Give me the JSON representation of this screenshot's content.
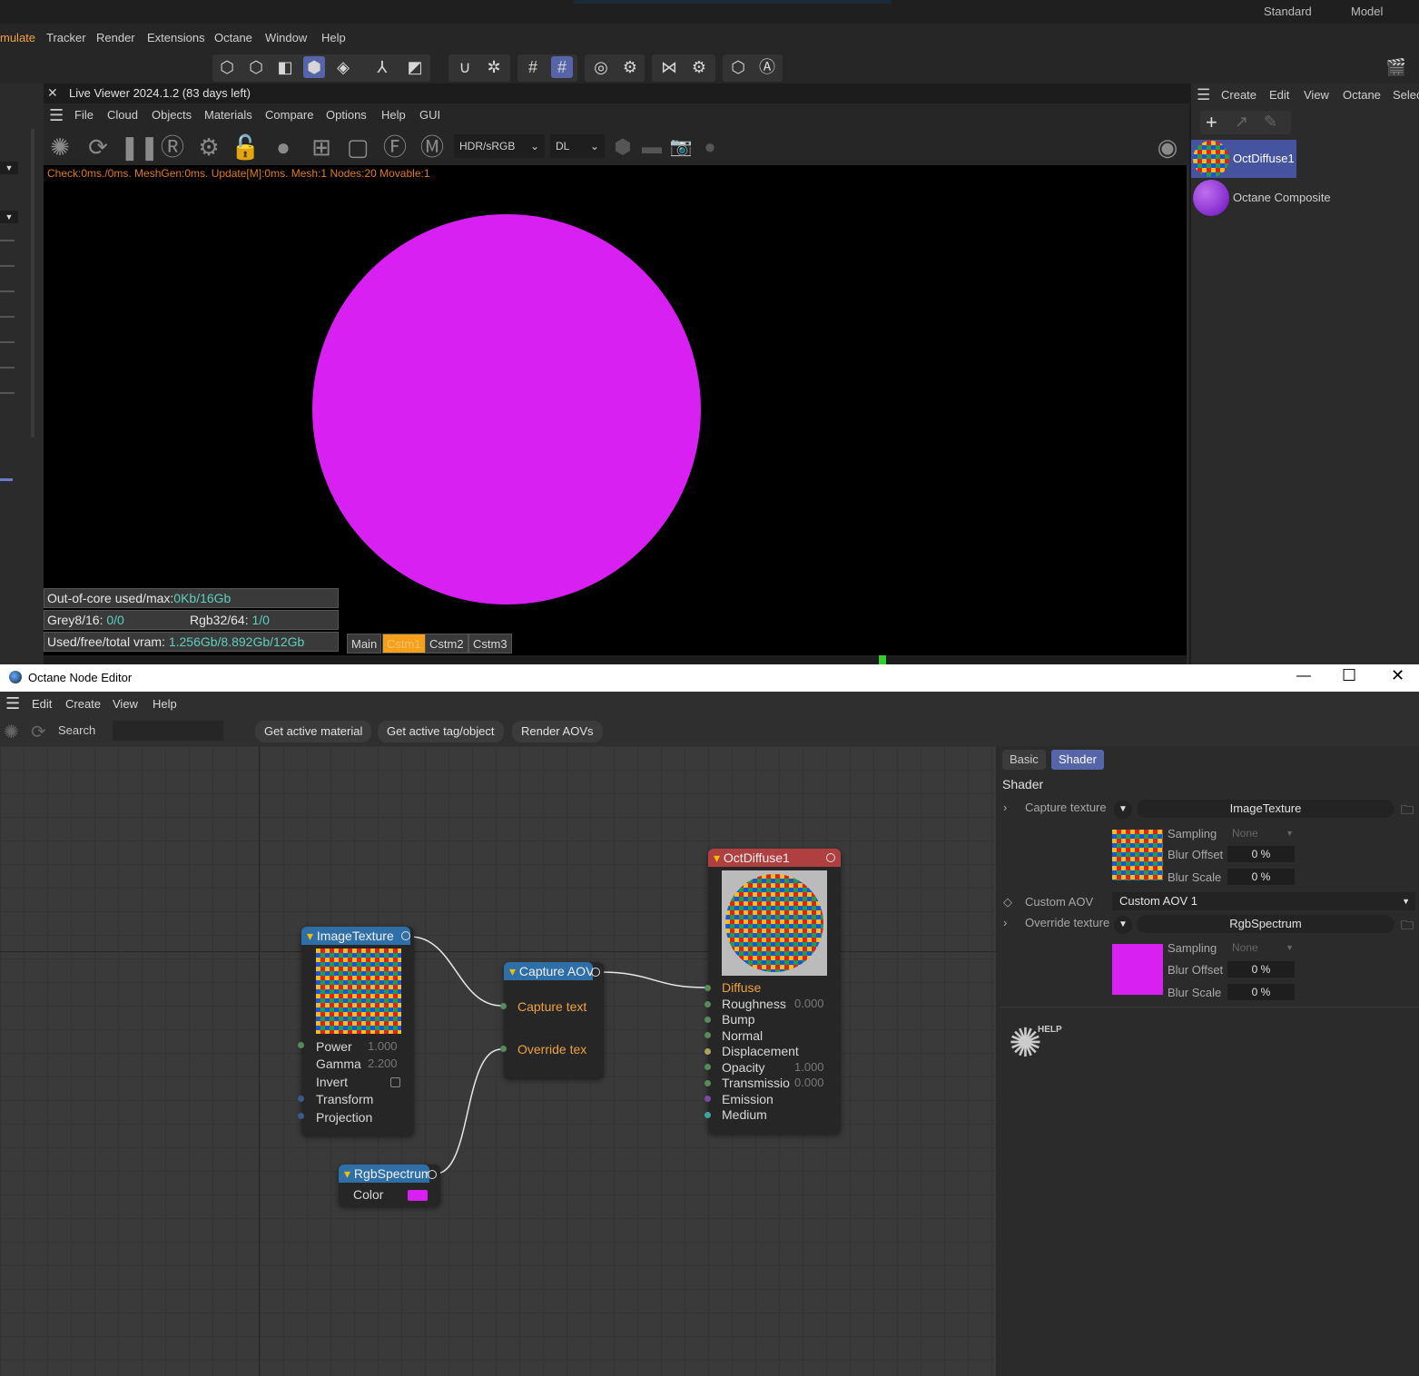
{
  "topbar": {
    "layout_1": "Standard",
    "layout_2": "Model"
  },
  "app_menu": [
    "mulate",
    "Tracker",
    "Render",
    "Extensions",
    "Octane",
    "Window",
    "Help"
  ],
  "live_viewer": {
    "title": "Live Viewer 2024.1.2 (83 days left)",
    "menu": [
      "File",
      "Cloud",
      "Objects",
      "Materials",
      "Compare",
      "Options",
      "Help",
      "GUI"
    ],
    "dropdown_1": "HDR/sRGB",
    "dropdown_2": "DL",
    "stats": "Check:0ms./0ms. MeshGen:0ms. Update[M]:0ms. Mesh:1 Nodes:20 Movable:1",
    "ooc_label": "Out-of-core used/max:",
    "ooc_value": "0Kb/16Gb",
    "grey_label": "Grey8/16: ",
    "grey_value": "0/0",
    "rgb_label": "Rgb32/64: ",
    "rgb_value": "1/0",
    "vram_label": "Used/free/total vram: ",
    "vram_value": "1.256Gb/8.892Gb/12Gb",
    "tabs": [
      "Main",
      "Cstm1",
      "Cstm2",
      "Cstm3"
    ],
    "sphere_color": "#d820f3"
  },
  "material_panel": {
    "menu": [
      "Create",
      "Edit",
      "View",
      "Octane",
      "Selec"
    ],
    "materials": [
      {
        "name": "OctDiffuse1"
      },
      {
        "name": "Octane Composite"
      }
    ]
  },
  "node_editor": {
    "title": "Octane Node Editor",
    "menu": [
      "Edit",
      "Create",
      "View",
      "Help"
    ],
    "search_label": "Search",
    "buttons": [
      "Get active material",
      "Get active tag/object",
      "Render AOVs"
    ],
    "nodes": {
      "image_texture": {
        "title": "ImageTexture",
        "pins": [
          {
            "label": "Power",
            "value": "1.000"
          },
          {
            "label": "Gamma",
            "value": "2.200"
          },
          {
            "label": "Invert",
            "value": ""
          },
          {
            "label": "Transform",
            "value": ""
          },
          {
            "label": "Projection",
            "value": ""
          }
        ]
      },
      "rgb_spectrum": {
        "title": "RgbSpectrum",
        "pin": "Color",
        "color": "#d820f3"
      },
      "capture_aov": {
        "title": "Capture AOV",
        "pins": [
          "Capture text",
          "Override tex"
        ]
      },
      "oct_diffuse": {
        "title": "OctDiffuse1",
        "pins": [
          {
            "label": "Diffuse",
            "value": ""
          },
          {
            "label": "Roughness",
            "value": "0.000"
          },
          {
            "label": "Bump",
            "value": ""
          },
          {
            "label": "Normal",
            "value": ""
          },
          {
            "label": "Displacement",
            "value": ""
          },
          {
            "label": "Opacity",
            "value": "1.000"
          },
          {
            "label": "Transmissio",
            "value": "0.000"
          },
          {
            "label": "Emission",
            "value": ""
          },
          {
            "label": "Medium",
            "value": ""
          }
        ]
      }
    },
    "inspector": {
      "tabs": [
        "Basic",
        "Shader"
      ],
      "section": "Shader",
      "capture_texture_label": "Capture texture",
      "capture_texture_value": "ImageTexture",
      "custom_aov_label": "Custom AOV",
      "custom_aov_value": "Custom AOV 1",
      "override_texture_label": "Override texture",
      "override_texture_value": "RgbSpectrum",
      "sampling_label": "Sampling",
      "sampling_value": "None",
      "blur_offset_label": "Blur Offset",
      "blur_offset_value": "0 %",
      "blur_scale_label": "Blur Scale",
      "blur_scale_value": "0 %",
      "help_label": "HELP"
    }
  }
}
